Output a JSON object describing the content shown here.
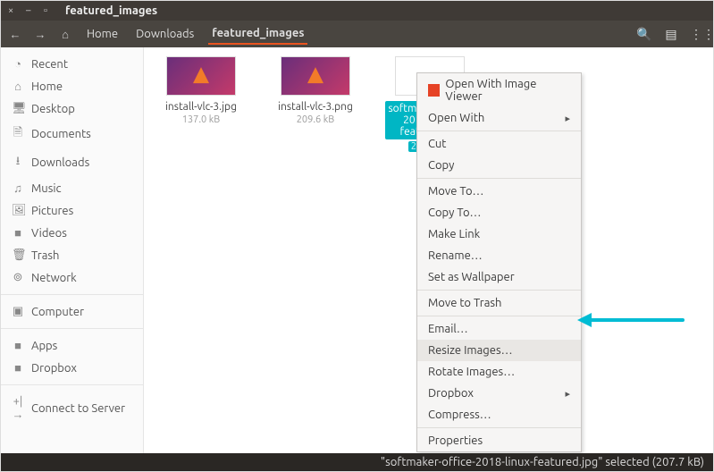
{
  "window": {
    "title": "featured_images"
  },
  "toolbar": {
    "home": "Home",
    "crumbs": [
      "Downloads",
      "featured_images"
    ]
  },
  "sidebar": {
    "items": [
      {
        "icon": "◔",
        "label": "Recent"
      },
      {
        "icon": "⌂",
        "label": "Home"
      },
      {
        "icon": "🖥",
        "label": "Desktop"
      },
      {
        "icon": "🗎",
        "label": "Documents"
      },
      {
        "icon": "⭳",
        "label": "Downloads"
      },
      {
        "icon": "♫",
        "label": "Music"
      },
      {
        "icon": "🖼",
        "label": "Pictures"
      },
      {
        "icon": "■",
        "label": "Videos"
      },
      {
        "icon": "🗑",
        "label": "Trash"
      },
      {
        "icon": "⊚",
        "label": "Network"
      }
    ],
    "computer": {
      "icon": "▣",
      "label": "Computer"
    },
    "places": [
      {
        "icon": "■",
        "label": "Apps"
      },
      {
        "icon": "■",
        "label": "Dropbox"
      }
    ],
    "connect": {
      "icon": "+|→",
      "label": "Connect to Server"
    }
  },
  "files": [
    {
      "name": "install-vlc-3.jpg",
      "size": "137.0 kB"
    },
    {
      "name": "install-vlc-3.png",
      "size": "209.6 kB"
    },
    {
      "name": "softmaker-office-2018-linux-featured.jpg",
      "size": "207.7 kB"
    }
  ],
  "menu": {
    "open_with_viewer": "Open With Image Viewer",
    "open_with": "Open With",
    "cut": "Cut",
    "copy": "Copy",
    "move_to": "Move To…",
    "copy_to": "Copy To…",
    "make_link": "Make Link",
    "rename": "Rename…",
    "set_wallpaper": "Set as Wallpaper",
    "move_trash": "Move to Trash",
    "email": "Email…",
    "resize": "Resize Images…",
    "rotate": "Rotate Images…",
    "dropbox": "Dropbox",
    "compress": "Compress…",
    "properties": "Properties"
  },
  "status": "\"softmaker-office-2018-linux-featured.jpg\" selected (207.7 kB)"
}
